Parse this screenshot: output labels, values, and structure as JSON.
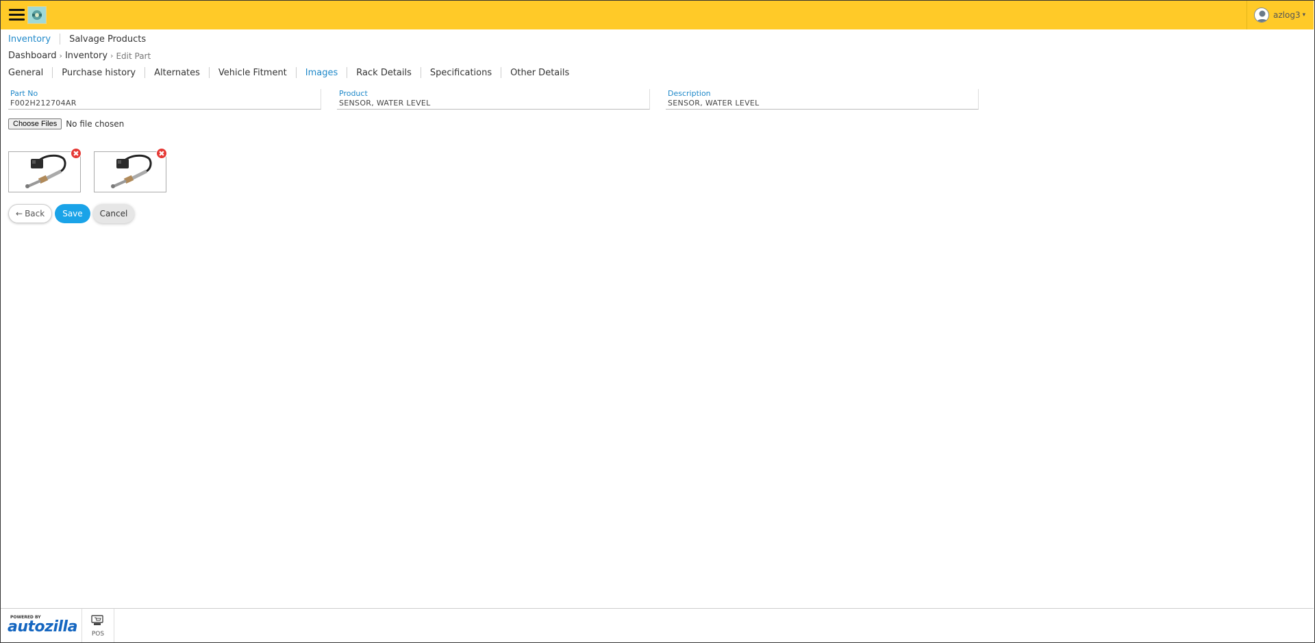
{
  "header": {
    "user_name": "azlog3"
  },
  "module_nav": [
    "Inventory",
    "Salvage Products"
  ],
  "breadcrumb": {
    "items": [
      "Dashboard",
      "Inventory"
    ],
    "current": "Edit Part"
  },
  "tabs": [
    "General",
    "Purchase history",
    "Alternates",
    "Vehicle Fitment",
    "Images",
    "Rack Details",
    "Specifications",
    "Other Details"
  ],
  "active_tab": "Images",
  "fields": {
    "part_no": {
      "label": "Part No",
      "value": "F002H212704AR"
    },
    "product": {
      "label": "Product",
      "value": "SENSOR, WATER LEVEL"
    },
    "description": {
      "label": "Description",
      "value": "SENSOR, WATER LEVEL"
    }
  },
  "file_input": {
    "button_label": "Choose Files",
    "status": "No file chosen"
  },
  "images": [
    {
      "remove_glyph": "✖"
    },
    {
      "remove_glyph": "✖"
    }
  ],
  "actions": {
    "back": "Back",
    "back_icon": "←",
    "save": "Save",
    "cancel": "Cancel"
  },
  "footer": {
    "powered_by": "POWERED BY",
    "brand": "autozilla",
    "pos_label": "POS"
  },
  "colors": {
    "header_bg": "#ffca28",
    "accent": "#1e88c9",
    "save_bg": "#1aa3e8",
    "remove": "#e53935"
  }
}
